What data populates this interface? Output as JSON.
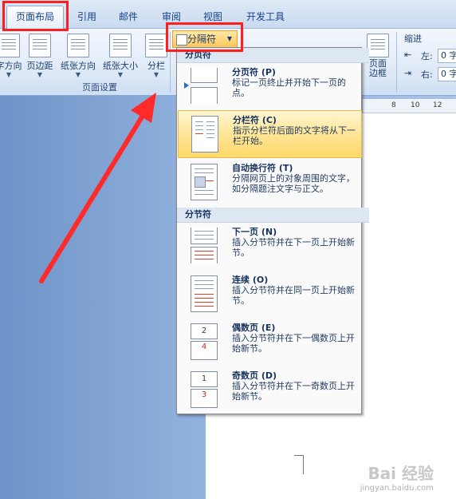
{
  "tabs": [
    {
      "label": "页面布局",
      "active": true
    },
    {
      "label": "引用"
    },
    {
      "label": "邮件"
    },
    {
      "label": "审阅"
    },
    {
      "label": "视图"
    },
    {
      "label": "开发工具"
    }
  ],
  "ribbon": {
    "page_setup": {
      "text_direction": "字方向",
      "margins": "页边距",
      "orientation": "纸张方向",
      "size": "纸张大小",
      "columns": "分栏",
      "group_label": "页面设置"
    },
    "breaks_button": "分隔符",
    "page_borders": "页面\n边框",
    "indent": {
      "label": "缩进",
      "left_label": "左:",
      "left_value": "0 字",
      "right_label": "右:",
      "right_value": "0 字"
    }
  },
  "ruler": {
    "ticks": [
      "8",
      "10",
      "12"
    ]
  },
  "menu": {
    "page_breaks_header": "分页符",
    "section_breaks_header": "分节符",
    "items": [
      {
        "title": "分页符 (P)",
        "desc": "标记一页终止并开始下一页的点。"
      },
      {
        "title": "分栏符 (C)",
        "desc": "指示分栏符后面的文字将从下一栏开始。"
      },
      {
        "title": "自动换行符 (T)",
        "desc": "分隔网页上的对象周围的文字，如分隔题注文字与正文。"
      },
      {
        "title": "下一页 (N)",
        "desc": "插入分节符并在下一页上开始新节。"
      },
      {
        "title": "连续 (O)",
        "desc": "插入分节符并在同一页上开始新节。"
      },
      {
        "title": "偶数页 (E)",
        "desc": "插入分节符并在下一偶数页上开始新节。"
      },
      {
        "title": "奇数页 (D)",
        "desc": "插入分节符并在下一奇数页上开始新节。"
      }
    ]
  },
  "thumb_numbers": {
    "even_a": "2",
    "even_b": "4",
    "odd_a": "1",
    "odd_b": "3"
  },
  "watermark": {
    "brand": "Bai 经验",
    "url": "jingyan.baidu.com"
  },
  "colors": {
    "highlight_box": "#ff1e1e",
    "arrow": "#ff2a2a",
    "menu_hover": "#ffd86b"
  }
}
